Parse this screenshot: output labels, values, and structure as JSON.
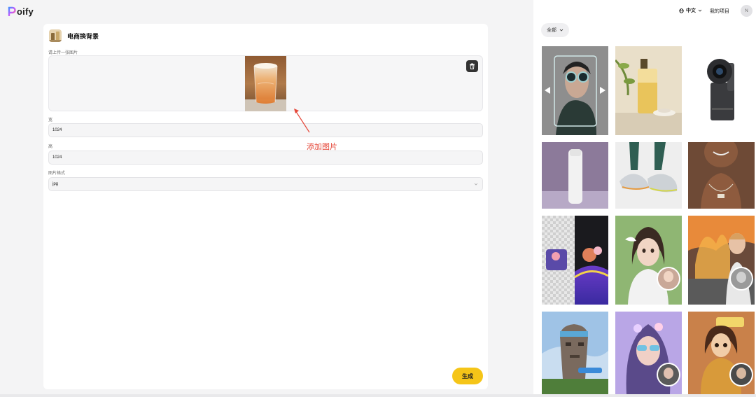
{
  "brand": {
    "logo_text": "oify"
  },
  "card": {
    "title": "电商换背景",
    "upload_label": "请上传一张图片",
    "width_label": "宽",
    "width_value": "1024",
    "height_label": "高",
    "height_value": "1024",
    "format_label": "图片格式",
    "format_value": "jpg",
    "generate_label": "生成"
  },
  "annotation": {
    "text": "添加图片",
    "color": "#e5483a"
  },
  "topnav": {
    "language": "中文",
    "my_projects": "我的项目",
    "avatar_initial": "N"
  },
  "filter": {
    "label": "全部"
  },
  "gallery": {
    "items": [
      {
        "name": "gallery-item-goggles-face-swap"
      },
      {
        "name": "gallery-item-serum-bottle"
      },
      {
        "name": "gallery-item-webcam-device"
      },
      {
        "name": "gallery-item-white-bottle"
      },
      {
        "name": "gallery-item-sneakers"
      },
      {
        "name": "gallery-item-necklace-portrait"
      },
      {
        "name": "gallery-item-background-removal"
      },
      {
        "name": "gallery-item-girl-with-bird"
      },
      {
        "name": "gallery-item-fire-scene-faceswap"
      },
      {
        "name": "gallery-item-moai-figure"
      },
      {
        "name": "gallery-item-purple-hair-woman"
      },
      {
        "name": "gallery-item-cartoon-girl"
      }
    ]
  },
  "colors": {
    "accent": "#f5c518",
    "page_bg": "#f4f4f5",
    "panel_bg": "#ffffff"
  }
}
